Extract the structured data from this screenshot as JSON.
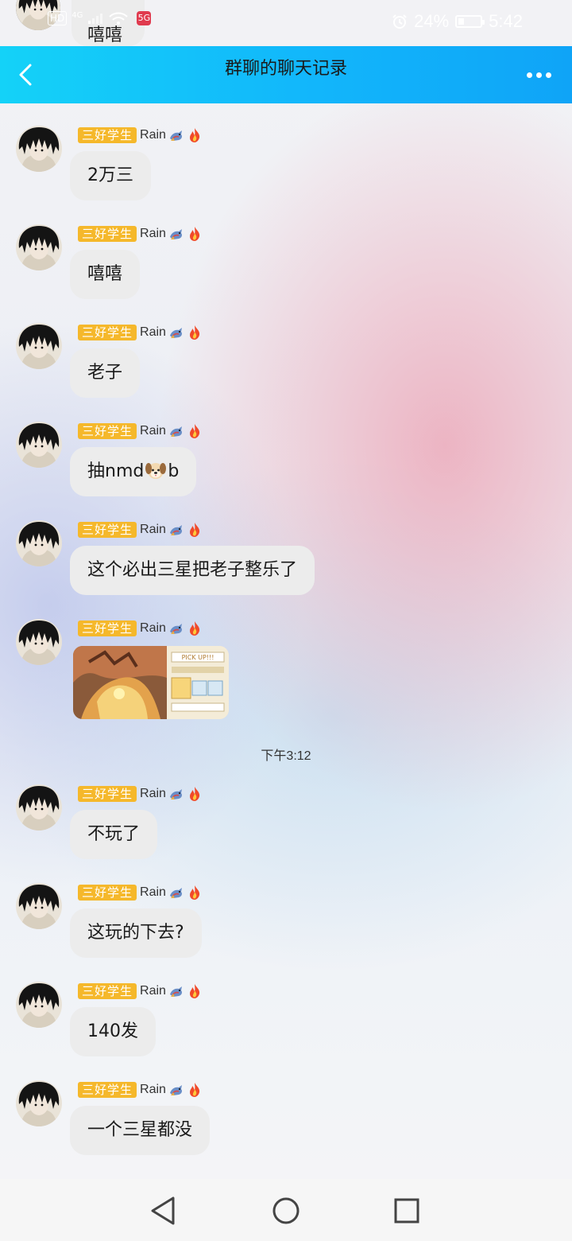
{
  "status_bar": {
    "network_tag": "HD",
    "network_type": "4G",
    "app_icon_text": "5G",
    "battery": "24%",
    "time": "5:42"
  },
  "previous_message": {
    "text": "嘻嘻"
  },
  "header": {
    "title": "群聊的聊天记录"
  },
  "sender": {
    "badge": "三好学生",
    "name": "Rain"
  },
  "messages": [
    {
      "text": "2万三"
    },
    {
      "text": "嘻嘻"
    },
    {
      "text": "老子"
    },
    {
      "text_before": "抽nmd",
      "text_after": "b"
    },
    {
      "text": "这个必出三星把老子整乐了"
    },
    {
      "type": "image",
      "caption": "PICK UP!!!"
    },
    {
      "text": "不玩了"
    },
    {
      "text": "这玩的下去?"
    },
    {
      "text": "140发"
    },
    {
      "text": "一个三星都没"
    }
  ],
  "timestamp": "下午3:12",
  "icons": {
    "back": "chevron-left-icon",
    "more": "more-dots-icon",
    "emoji_1": "dragon-icon",
    "emoji_2": "fire-icon",
    "dog": "dog-face-emoji",
    "nav_back": "triangle-back-icon",
    "nav_home": "circle-home-icon",
    "nav_recent": "square-recent-icon"
  },
  "colors": {
    "header_start": "#14d2f8",
    "header_end": "#0fa4f7",
    "badge": "#f5b82b",
    "bubble": "#ececec"
  }
}
